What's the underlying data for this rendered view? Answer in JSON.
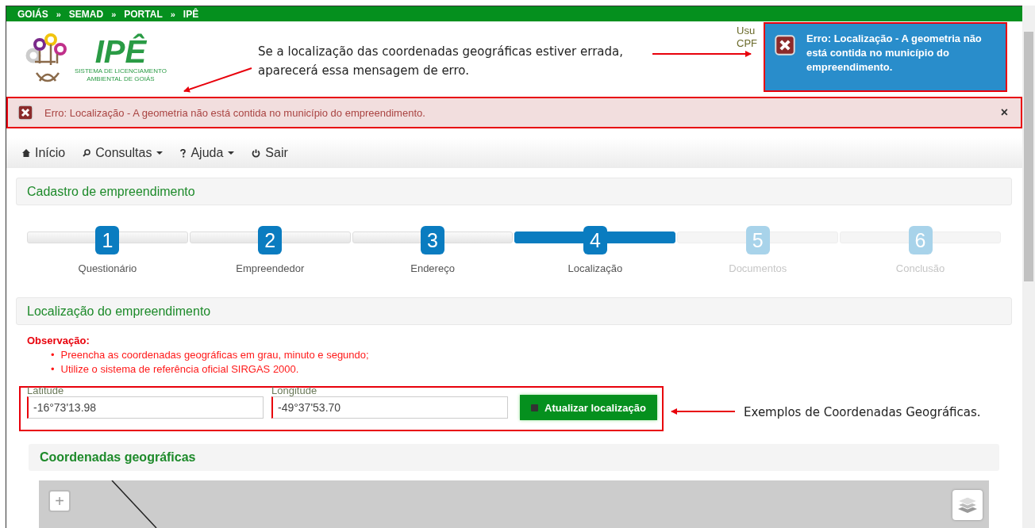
{
  "breadcrumb": {
    "items": [
      "GOIÁS",
      "SEMAD",
      "PORTAL",
      "IPÊ"
    ],
    "separator": "»"
  },
  "logo": {
    "title": "IPÊ",
    "subtitle": "SISTEMA DE LICENCIAMENTO AMBIENTAL DE GOIÁS"
  },
  "user_info": [
    "Usu",
    "CPF"
  ],
  "toast": {
    "message": "Erro: Localização - A geometria não está contida no município do empreendimento."
  },
  "alert": {
    "message": "Erro: Localização - A geometria não está contida no município do empreendimento.",
    "close": "×"
  },
  "nav": [
    {
      "kind": "home",
      "label": "Início",
      "dropdown": false
    },
    {
      "kind": "search",
      "label": "Consultas",
      "dropdown": true
    },
    {
      "kind": "help",
      "label": "Ajuda",
      "dropdown": true
    },
    {
      "kind": "power",
      "label": "Sair",
      "dropdown": false
    }
  ],
  "page_title": "Cadastro de empreendimento",
  "steps": [
    {
      "number": "1",
      "label": "Questionário",
      "selected": false,
      "disabled": false
    },
    {
      "number": "2",
      "label": "Empreendedor",
      "selected": false,
      "disabled": false
    },
    {
      "number": "3",
      "label": "Endereço",
      "selected": false,
      "disabled": false
    },
    {
      "number": "4",
      "label": "Localização",
      "selected": true,
      "disabled": false
    },
    {
      "number": "5",
      "label": "Documentos",
      "selected": false,
      "disabled": true
    },
    {
      "number": "6",
      "label": "Conclusão",
      "selected": false,
      "disabled": true
    }
  ],
  "section_title": "Localização do empreendimento",
  "observation": {
    "title": "Observação:",
    "bullet": "•",
    "items": [
      "Preencha as coordenadas geográficas em grau, minuto e segundo;",
      "Utilize o sistema de referência oficial SIRGAS 2000."
    ]
  },
  "fields": [
    {
      "label": "Latitude",
      "value": "-16°73'13.98"
    },
    {
      "label": "Longitude",
      "value": "-49°37'53.70"
    }
  ],
  "update_button": "Atualizar localização",
  "map_panel": {
    "title": "Coordenadas geográficas",
    "zoom_in": "+"
  },
  "annotations": [
    "Se a localização das coordenadas geográficas estiver errada, aparecerá essa mensagem de erro.",
    "Exemplos de Coordenadas Geográficas."
  ]
}
